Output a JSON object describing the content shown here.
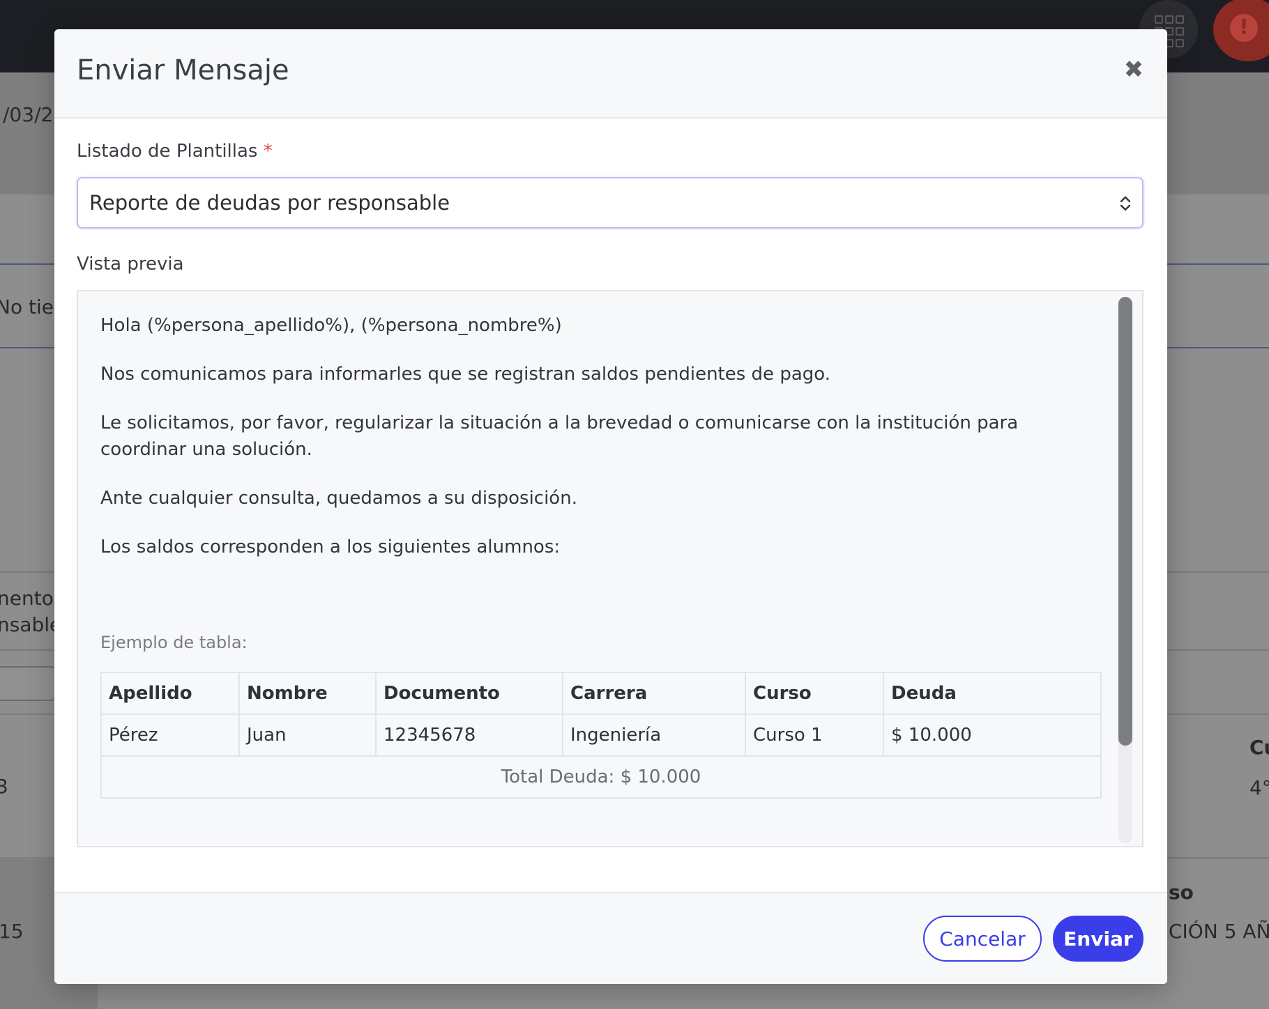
{
  "background": {
    "date_fragment": "/03/2",
    "notice_fragment": "No tien",
    "label_fragment_1": "nento",
    "label_fragment_2": "nsable",
    "row_value_1": "3",
    "row_value_2": "15",
    "col_header_fragment": "Cu",
    "col_value_fragment": "4°",
    "col2_header_fragment": "so",
    "col2_value_fragment": "CIÓN 5 AÑO"
  },
  "modal": {
    "title": "Enviar Mensaje",
    "close_glyph": "✖",
    "templates": {
      "label": "Listado de Plantillas",
      "required_mark": "*",
      "selected": "Reporte de deudas por responsable"
    },
    "preview": {
      "label": "Vista previa",
      "greeting": "Hola (%persona_apellido%), (%persona_nombre%)",
      "para1": "Nos comunicamos para informarles que se registran saldos pendientes de pago.",
      "para2": "Le solicitamos, por favor, regularizar la situación a la brevedad o comunicarse con la institución para coordinar una solución.",
      "para3": "Ante cualquier consulta, quedamos a su disposición.",
      "para4": "Los saldos corresponden a los siguientes alumnos:",
      "table_caption": "Ejemplo de tabla:",
      "table": {
        "headers": [
          "Apellido",
          "Nombre",
          "Documento",
          "Carrera",
          "Curso",
          "Deuda"
        ],
        "rows": [
          [
            "Pérez",
            "Juan",
            "12345678",
            "Ingeniería",
            "Curso 1",
            "$ 10.000"
          ]
        ],
        "total": "Total Deuda: $ 10.000"
      }
    },
    "footer": {
      "cancel_label": "Cancelar",
      "send_label": "Enviar"
    }
  }
}
